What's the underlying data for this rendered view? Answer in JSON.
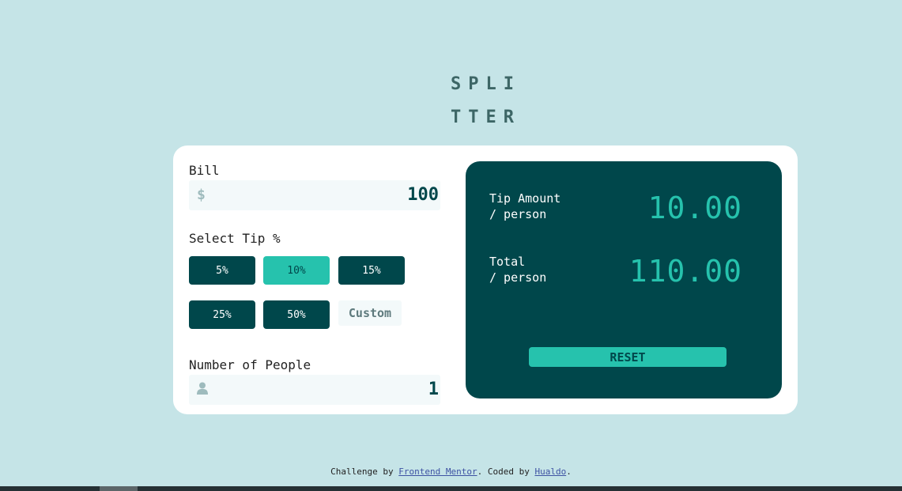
{
  "logo": {
    "line1": "SPLI",
    "line2": "TTER"
  },
  "bill": {
    "label": "Bill",
    "currency_symbol": "$",
    "value": "100"
  },
  "tip": {
    "label": "Select Tip %",
    "options": [
      "5%",
      "10%",
      "15%",
      "25%",
      "50%"
    ],
    "selected": "10%",
    "custom_placeholder": "Custom"
  },
  "people": {
    "label": "Number of People",
    "icon": "person-icon",
    "value": "1"
  },
  "results": {
    "tip_label_line1": "Tip Amount",
    "tip_label_line2": "/ person",
    "tip_value": "10.00",
    "total_label_line1": "Total",
    "total_label_line2": "/ person",
    "total_value": "110.00",
    "reset_label": "RESET"
  },
  "footer": {
    "prefix": "Challenge by ",
    "link1": "Frontend Mentor",
    "middle": ". Coded by ",
    "link2": "Hualdo",
    "suffix": "."
  },
  "colors": {
    "background": "#c5e4e7",
    "dark_cyan": "#00474b",
    "strong_cyan": "#26c2ad",
    "input_bg": "#f3f9fa"
  }
}
